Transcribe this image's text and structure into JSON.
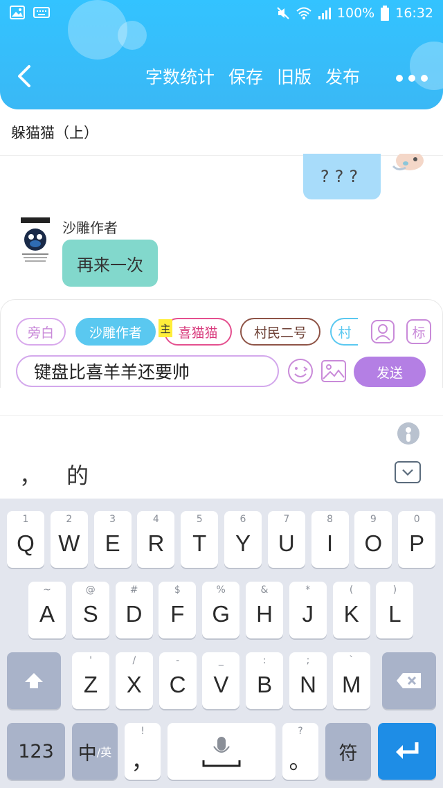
{
  "status_bar": {
    "battery": "100%",
    "time": "16:32"
  },
  "header": {
    "actions": [
      "字数统计",
      "保存",
      "旧版",
      "发布"
    ]
  },
  "document": {
    "title": "躲猫猫（上）"
  },
  "chat": {
    "right_message": "???",
    "left_sender": "沙雕作者",
    "left_message": "再来一次"
  },
  "composer": {
    "roles": [
      "旁白",
      "沙雕作者",
      "喜猫猫",
      "村民二号",
      "村"
    ],
    "main_badge": "主",
    "tag_button": "标",
    "input_value": "键盘比喜羊羊还要帅",
    "send_label": "发送"
  },
  "ime": {
    "candidates": [
      "，",
      "的"
    ]
  },
  "keyboard": {
    "row1": [
      {
        "num": "1",
        "ch": "Q"
      },
      {
        "num": "2",
        "ch": "W"
      },
      {
        "num": "3",
        "ch": "E"
      },
      {
        "num": "4",
        "ch": "R"
      },
      {
        "num": "5",
        "ch": "T"
      },
      {
        "num": "6",
        "ch": "Y"
      },
      {
        "num": "7",
        "ch": "U"
      },
      {
        "num": "8",
        "ch": "I"
      },
      {
        "num": "9",
        "ch": "O"
      },
      {
        "num": "0",
        "ch": "P"
      }
    ],
    "row2": [
      {
        "num": "~",
        "ch": "A"
      },
      {
        "num": "@",
        "ch": "S"
      },
      {
        "num": "#",
        "ch": "D"
      },
      {
        "num": "$",
        "ch": "F"
      },
      {
        "num": "%",
        "ch": "G"
      },
      {
        "num": "&",
        "ch": "H"
      },
      {
        "num": "*",
        "ch": "J"
      },
      {
        "num": "(",
        "ch": "K"
      },
      {
        "num": ")",
        "ch": "L"
      }
    ],
    "row3": [
      {
        "num": "'",
        "ch": "Z"
      },
      {
        "num": "/",
        "ch": "X"
      },
      {
        "num": "-",
        "ch": "C"
      },
      {
        "num": "_",
        "ch": "V"
      },
      {
        "num": ":",
        "ch": "B"
      },
      {
        "num": ";",
        "ch": "N"
      },
      {
        "num": "`",
        "ch": "M"
      }
    ],
    "bottom": {
      "num_key": "123",
      "lang_key_main": "中",
      "lang_key_sub": "/英",
      "comma_top": "!",
      "comma": "，",
      "period_top": "?",
      "period": "。",
      "symbol_key": "符"
    }
  },
  "colors": {
    "header": "#3ab8f5",
    "send_button": "#b47fe4",
    "right_bubble": "#a8dcfa",
    "left_bubble": "#82d8cc",
    "enter_key": "#1e8de6"
  },
  "icons": [
    "image-icon",
    "keyboard-icon",
    "mute-icon",
    "wifi-icon",
    "signal-icon",
    "battery-icon",
    "back-arrow-icon",
    "more-icon",
    "person-card-icon",
    "emoji-icon",
    "picture-icon",
    "ime-logo-icon",
    "collapse-keyboard-icon",
    "shift-icon",
    "backspace-icon",
    "microphone-icon",
    "enter-icon"
  ]
}
